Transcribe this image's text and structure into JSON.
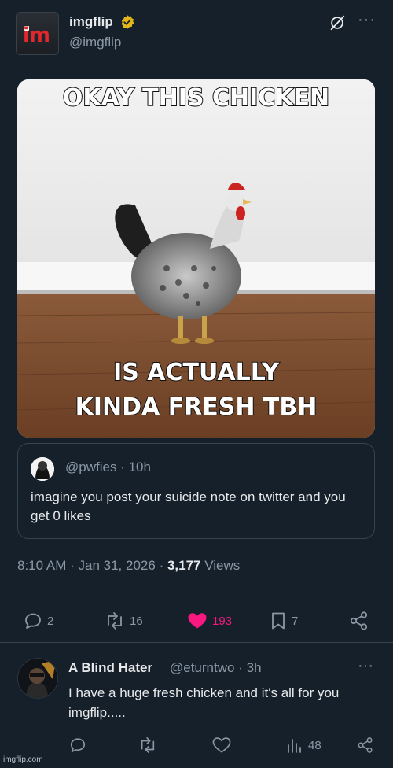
{
  "author": {
    "display_name": "imgflip",
    "handle": "@imgflip",
    "avatar_text": "im",
    "verified_badge_icon": "verified-gold-badge-icon"
  },
  "meme": {
    "top_text": "OKAY THIS CHICKEN",
    "bottom_line1": "IS ACTUALLY",
    "bottom_line2": "KINDA FRESH TBH"
  },
  "quote": {
    "handle": "@pwfies",
    "separator": "·",
    "time": "10h",
    "text": "imagine you post your suicide note on twitter and you get 0 likes"
  },
  "post_meta": {
    "time": "8:10 AM",
    "date": "Jan 31, 2026",
    "separator": "·",
    "views_count": "3,177",
    "views_label": "Views"
  },
  "actions": {
    "replies": "2",
    "reposts": "16",
    "likes": "193",
    "bookmarks": "7"
  },
  "reply": {
    "display_name": "A Blind Hater",
    "handle": "@eturntwo",
    "separator": "·",
    "time": "3h",
    "text": "I have a huge fresh chicken and it's all for you imgflip.....",
    "views": "48"
  },
  "watermark": "imgflip.com",
  "colors": {
    "background": "#15202b",
    "like_active": "#f91880",
    "muted": "#8b98a5",
    "divider": "#38444d",
    "verified": "#e2b719"
  }
}
